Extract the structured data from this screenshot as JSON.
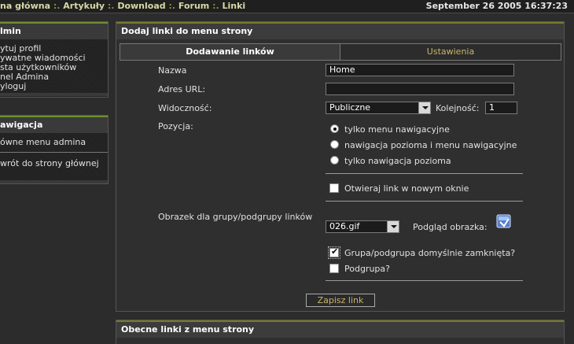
{
  "nav": {
    "items": [
      "na główna",
      "Artykuły",
      "Download",
      "Forum",
      "Linki"
    ],
    "separator": ":."
  },
  "datetime": "September 26 2005 16:37:23",
  "sidebar": {
    "admin_box": {
      "title": "lmin",
      "items": [
        "ytuj profil",
        "ywatne wiadomości",
        "sta użytkowników",
        "nel Admina",
        "yloguj"
      ]
    },
    "nav_box": {
      "title": "awigacja",
      "items": [
        "ówne menu admina",
        "wrót do strony głównej"
      ]
    }
  },
  "panel": {
    "title": "Dodaj linki do menu strony",
    "tabs": {
      "active": "Dodawanie linków",
      "inactive": "Ustawienia"
    },
    "form": {
      "name_label": "Nazwa",
      "name_value": "Home",
      "url_label": "Adres URL:",
      "url_value": "",
      "visibility_label": "Widoczność:",
      "visibility_value": "Publiczne",
      "order_label": "Kolejność:",
      "order_value": "1",
      "position_label": "Pozycja:",
      "positions": [
        "tylko menu nawigacyjne",
        "nawigacja pozioma i menu nawigacyjne",
        "tylko nawigacja pozioma"
      ],
      "new_window_label": "Otwieraj link w nowym oknie",
      "image_label": "Obrazek dla grupy/podgrupy linków",
      "image_value": "026.gif",
      "preview_label": "Podgląd obrazka:",
      "group_closed_label": "Grupa/podgrupa domyślnie zamknięta?",
      "subgroup_label": "Podgrupa?",
      "save_label": "Zapisz link"
    }
  },
  "panel2": {
    "title": "Obecne linki z menu strony"
  }
}
